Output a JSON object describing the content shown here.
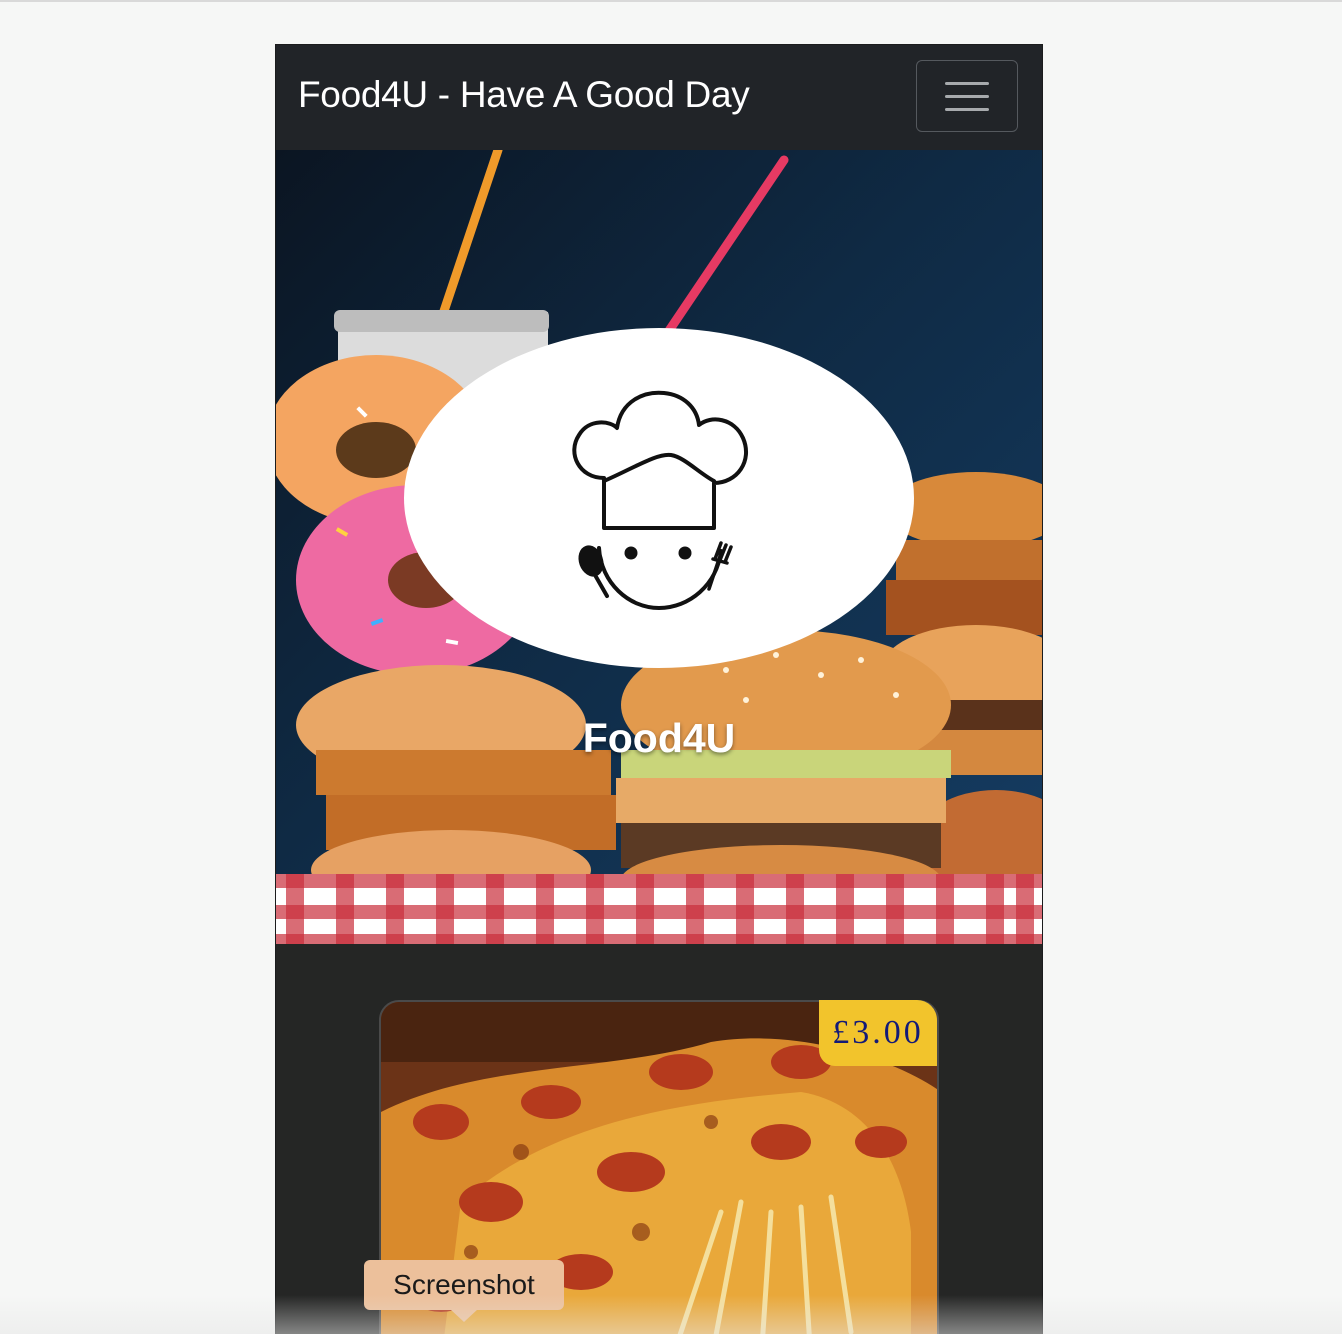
{
  "navbar": {
    "brand": "Food4U - Have A Good Day",
    "toggler_icon": "hamburger-menu-icon"
  },
  "hero": {
    "image": "fast-food-burgers-donuts-photo",
    "logo_icon": "chef-hat-face-icon",
    "title": "Food4U"
  },
  "card": {
    "image": "pepperoni-pizza-photo",
    "price": "£3.00"
  },
  "tooltip": {
    "label": "Screenshot"
  },
  "colors": {
    "navbar_bg": "#212428",
    "body_bg": "#252625",
    "price_badge": "#f2c42c",
    "price_text": "#131a78",
    "tooltip_bg": "#ecc09b"
  }
}
